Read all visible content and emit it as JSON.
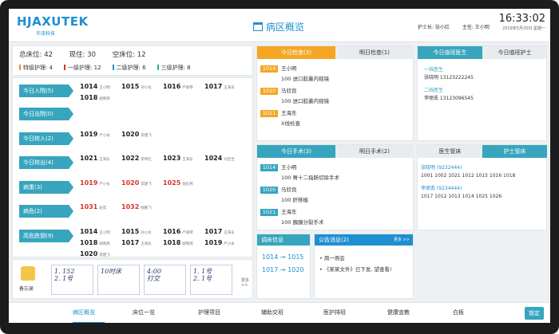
{
  "brand": {
    "name": "HJAXUTEK",
    "sub": "华泽科技"
  },
  "page_title": "病区概览",
  "staff": {
    "head_nurse": "护士长:  张小红",
    "director": "主任:  王小明"
  },
  "clock": {
    "time": "16:33:02",
    "date": "2019年5月20日 星期一"
  },
  "summary": {
    "total_beds": "总床位: 42",
    "occupied": "现住: 30",
    "empty": "空床位: 12",
    "care_levels": [
      {
        "label": "特级护理: 4",
        "color": "#f08a24"
      },
      {
        "label": "一级护理: 12",
        "color": "#d9322d"
      },
      {
        "label": "二级护理: 6",
        "color": "#1e8fd0"
      },
      {
        "label": "三级护理: 8",
        "color": "#2fb58a"
      }
    ]
  },
  "events": [
    {
      "tag": "今日入院(5)",
      "beds": [
        {
          "n": "1014",
          "nm": "王小明"
        },
        {
          "n": "1015",
          "nm": "孙小龙"
        },
        {
          "n": "1016",
          "nm": "严丽琴"
        },
        {
          "n": "1017",
          "nm": "王海东"
        },
        {
          "n": "1018",
          "nm": "胡晓燕"
        }
      ]
    },
    {
      "tag": "今日出院(0)",
      "beds": []
    },
    {
      "tag": "今日转入(2)",
      "beds": [
        {
          "n": "1019",
          "nm": "严小永"
        },
        {
          "n": "1020",
          "nm": "李建飞"
        }
      ]
    },
    {
      "tag": "今日转出(4)",
      "beds": [
        {
          "n": "1021",
          "nm": "王海东"
        },
        {
          "n": "1022",
          "nm": "李伟红"
        },
        {
          "n": "1023",
          "nm": "王海东"
        },
        {
          "n": "1024",
          "nm": "刘佳佳"
        }
      ]
    },
    {
      "tag": "病重(3)",
      "red": true,
      "beds": [
        {
          "n": "1019",
          "nm": "严小永"
        },
        {
          "n": "1020",
          "nm": "李建飞"
        },
        {
          "n": "1025",
          "nm": "张红燕"
        }
      ]
    },
    {
      "tag": "病危(2)",
      "red": true,
      "beds": [
        {
          "n": "1031",
          "nm": "赵欢"
        },
        {
          "n": "1032",
          "nm": "钱鹏飞"
        }
      ]
    },
    {
      "tag": "高危跌倒(9)",
      "beds": [
        {
          "n": "1014",
          "nm": "王小明"
        },
        {
          "n": "1015",
          "nm": "孙小龙"
        },
        {
          "n": "1016",
          "nm": "严丽琴"
        },
        {
          "n": "1017",
          "nm": "王海东"
        },
        {
          "n": "1018",
          "nm": "胡晓燕"
        },
        {
          "n": "1017",
          "nm": "王海东"
        },
        {
          "n": "1018",
          "nm": "胡晓燕"
        },
        {
          "n": "1019",
          "nm": "严小永"
        },
        {
          "n": "1020",
          "nm": "李建飞"
        }
      ]
    }
  ],
  "memo": {
    "label": "备忘录",
    "notes": [
      "1. 152\n2. 1号",
      "10时床",
      "4:00\n打交",
      "1. 1号\n2. 1号"
    ],
    "more": "更多 >>"
  },
  "check": {
    "tabs": [
      "今日检查(3)",
      "明日检查(1)"
    ],
    "rows": [
      {
        "room": "1014",
        "name": "王小明",
        "item": "100  进口胶囊内窥镜"
      },
      {
        "room": "1020",
        "name": "马欣良",
        "item": "100  进口胶囊内窥镜"
      },
      {
        "room": "1021",
        "name": "王海东",
        "item": "X线检查"
      }
    ]
  },
  "surgery": {
    "tabs": [
      "今日手术(3)",
      "明日手术(2)"
    ],
    "rows": [
      {
        "room": "1014",
        "name": "王小明",
        "item": "100  胃十二指肠切除手术"
      },
      {
        "room": "1020",
        "name": "马欣良",
        "item": "100  肝移植"
      },
      {
        "room": "1021",
        "name": "王海东",
        "item": "100  胰腺分裂手术"
      }
    ]
  },
  "duty": {
    "tabs": [
      "今日值班医生",
      "今日值班护士"
    ],
    "doctors": [
      {
        "role": "一线医生",
        "info": "张晓明  13123222245"
      },
      {
        "role": "二线医生",
        "info": "李丽丢  13123096545"
      }
    ]
  },
  "managers": {
    "tabs": [
      "医生管床",
      "护士管床"
    ],
    "groups": [
      {
        "name": "张晓明  (9232444)",
        "beds": "1001  1002  1021  1012  1015  1016  1018"
      },
      {
        "name": "李丽丢  (9234444)",
        "beds": "1017  1012  1013  1014  1025  1026"
      }
    ]
  },
  "shift": {
    "title": "调床信息",
    "rows": [
      {
        "from": "1014",
        "to": "1015"
      },
      {
        "from": "1017",
        "to": "1020"
      }
    ]
  },
  "notice": {
    "title": "公告消息(2)",
    "more": "更多 >>",
    "items": [
      "周一例会",
      "《某某文件》已下发, 望查看!"
    ]
  },
  "nav": {
    "items": [
      "病区概览",
      "床位一览",
      "护理项目",
      "辅助交班",
      "医护排班",
      "健康宣教",
      "白板"
    ],
    "confirm": "锁定"
  }
}
